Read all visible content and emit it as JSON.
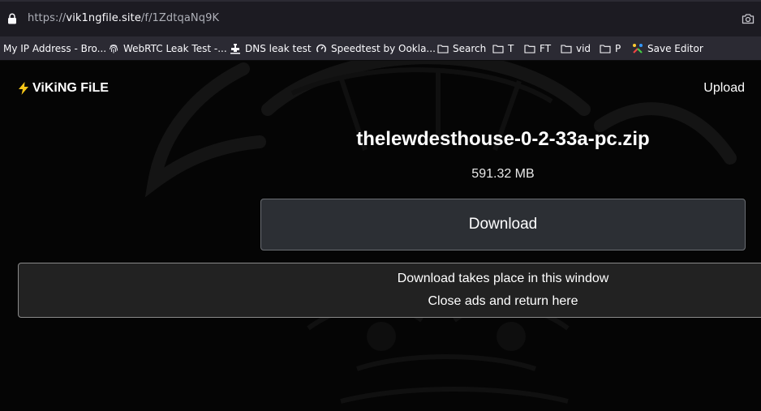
{
  "browser": {
    "url_prefix": "https://",
    "url_host": "vik1ngfile.site",
    "url_path": "/f/1ZdtqaNq9K",
    "bookmarks": [
      {
        "label": "My IP Address - Bro...",
        "icon": "none"
      },
      {
        "label": "WebRTC Leak Test -...",
        "icon": "fingerprint-icon"
      },
      {
        "label": "DNS leak test",
        "icon": "faucet-icon"
      },
      {
        "label": "Speedtest by Ookla...",
        "icon": "speedometer-icon"
      },
      {
        "label": "Search",
        "icon": "folder-icon"
      },
      {
        "label": "T",
        "icon": "folder-icon"
      },
      {
        "label": "FT",
        "icon": "folder-icon"
      },
      {
        "label": "vid",
        "icon": "folder-icon"
      },
      {
        "label": "P",
        "icon": "folder-icon"
      },
      {
        "label": "Save Editor",
        "icon": "tools-icon"
      }
    ]
  },
  "site": {
    "logo_text": "ViKiNG FiLE",
    "upload_label": "Upload"
  },
  "file": {
    "name": "thelewdesthouse-0-2-33a-pc.zip",
    "size": "591.32 MB",
    "download_label": "Download"
  },
  "notice": {
    "line1": "Download takes place in this window",
    "line2": "Close ads and return here"
  },
  "colors": {
    "background": "#050505",
    "button_bg": "#2c2f34",
    "notice_bg": "#222222",
    "logo_bolt": "#f5c518"
  }
}
